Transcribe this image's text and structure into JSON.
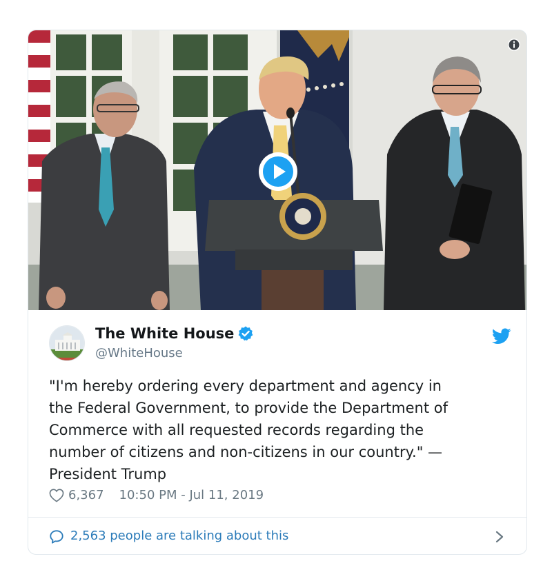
{
  "tweet": {
    "display_name": "The White House",
    "handle": "@WhiteHouse",
    "text": "\"I'm hereby ordering every department and agency in\nthe Federal Government, to provide the Department of\nCommerce with all requested records regarding the\nnumber of citizens and non-citizens in our country.\" —\nPresident Trump",
    "likes": "6,367",
    "timestamp": "10:50 PM - Jul 11, 2019"
  },
  "footer": {
    "talking_label": "2,563 people are talking about this"
  },
  "icons": {
    "info": "info-icon",
    "play": "play-icon",
    "verified": "verified-badge-icon",
    "twitter": "twitter-bird-icon",
    "heart": "heart-icon",
    "conversation": "speech-bubble-icon",
    "chevron": "chevron-right-icon"
  },
  "colors": {
    "twitter_blue": "#1da1f2",
    "link_blue": "#2b7bb9",
    "secondary_text": "#697882",
    "border": "#e1e8ed"
  }
}
